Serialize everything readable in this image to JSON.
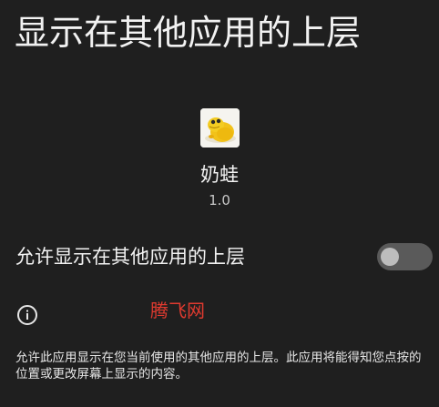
{
  "page": {
    "title": "显示在其他应用的上层"
  },
  "app": {
    "name": "奶蛙",
    "version": "1.0",
    "icon": "yellow-frog-icon"
  },
  "permission": {
    "label": "允许显示在其他应用的上层",
    "enabled": false
  },
  "info": {
    "icon": "info-icon",
    "watermark": "腾飞网",
    "description": "允许此应用显示在您当前使用的其他应用的上层。此应用将能得知您点按的位置或更改屏幕上显示的内容。"
  },
  "colors": {
    "background": "#1f1f1f",
    "switch_track_off": "#5a5a5a",
    "switch_thumb_off": "#bdbdbd",
    "watermark": "#e03a2f"
  }
}
